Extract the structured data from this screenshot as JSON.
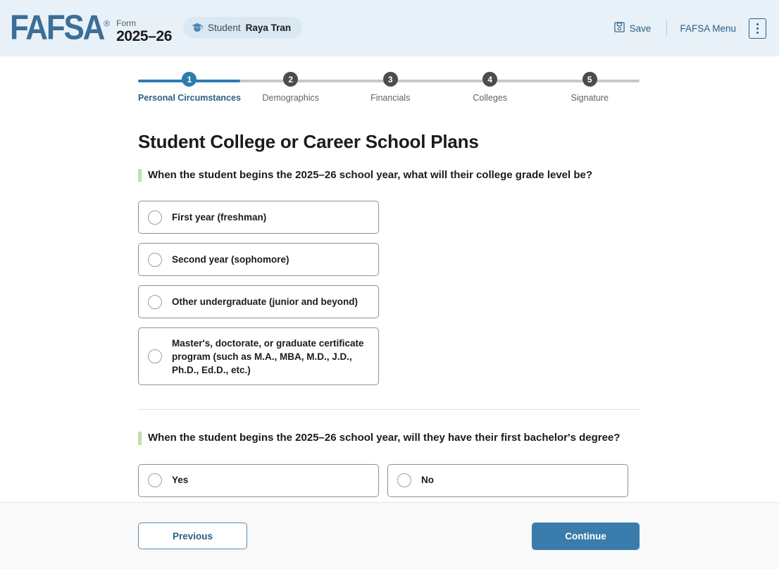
{
  "header": {
    "logo_text": "FAFSA",
    "registered_mark": "®",
    "form_label": "Form",
    "form_year": "2025–26",
    "student_badge": {
      "icon": "graduation-cap-icon",
      "role": "Student",
      "name": "Raya Tran"
    },
    "save_label": "Save",
    "save_icon": "floppy-disk-icon",
    "menu_label": "FAFSA Menu",
    "kebab_icon": "vertical-dots-icon"
  },
  "stepper": {
    "current_step": 1,
    "steps": [
      {
        "number": "1",
        "label": "Personal Circumstances",
        "state": "active"
      },
      {
        "number": "2",
        "label": "Demographics",
        "state": "upcoming"
      },
      {
        "number": "3",
        "label": "Financials",
        "state": "upcoming"
      },
      {
        "number": "4",
        "label": "Colleges",
        "state": "upcoming"
      },
      {
        "number": "5",
        "label": "Signature",
        "state": "upcoming"
      }
    ]
  },
  "main": {
    "page_title": "Student College or Career School Plans",
    "question1": {
      "text": "When the student begins the 2025–26 school year, what will their college grade level be?",
      "options": [
        {
          "label": "First year (freshman)",
          "selected": false
        },
        {
          "label": "Second year (sophomore)",
          "selected": false
        },
        {
          "label": "Other undergraduate (junior and beyond)",
          "selected": false
        },
        {
          "label": "Master's, doctorate, or graduate certificate program (such as M.A., MBA, M.D., J.D., Ph.D., Ed.D., etc.)",
          "selected": false
        }
      ]
    },
    "question2": {
      "text": "When the student begins the 2025–26 school year, will they have their first bachelor's degree?",
      "options": [
        {
          "label": "Yes",
          "selected": false
        },
        {
          "label": "No",
          "selected": false
        }
      ]
    }
  },
  "footer": {
    "previous_label": "Previous",
    "continue_label": "Continue"
  },
  "colors": {
    "brand_blue": "#3c6e96",
    "accent_blue": "#2e7cb0",
    "primary_button": "#3a7cab",
    "header_bg": "#e8f1f8",
    "question_accent": "#bde0ad",
    "step_inactive": "#4c4c4c"
  }
}
